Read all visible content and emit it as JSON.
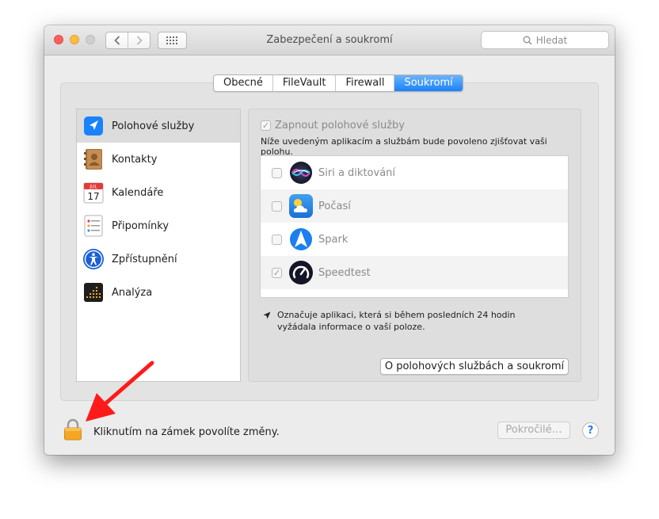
{
  "window": {
    "title": "Zabezpečení a soukromí",
    "search_placeholder": "Hledat"
  },
  "tabs": [
    {
      "label": "Obecné",
      "active": false
    },
    {
      "label": "FileVault",
      "active": false
    },
    {
      "label": "Firewall",
      "active": false
    },
    {
      "label": "Soukromí",
      "active": true
    }
  ],
  "sidebar": {
    "items": [
      {
        "label": "Polohové služby",
        "icon": "location-arrow-icon",
        "selected": true
      },
      {
        "label": "Kontakty",
        "icon": "contacts-icon",
        "selected": false
      },
      {
        "label": "Kalendáře",
        "icon": "calendar-icon",
        "icon_month": "JUL",
        "icon_day": "17",
        "selected": false
      },
      {
        "label": "Připomínky",
        "icon": "reminders-icon",
        "selected": false
      },
      {
        "label": "Zpřístupnění",
        "icon": "accessibility-icon",
        "selected": false
      },
      {
        "label": "Analýza",
        "icon": "analytics-icon",
        "selected": false
      }
    ]
  },
  "location": {
    "enable_label": "Zapnout polohové služby",
    "enable_checked": true,
    "description": "Níže uvedeným aplikacím a službám bude povoleno zjišťovat vaši polohu.",
    "apps": [
      {
        "name": "Siri a diktování",
        "checked": false,
        "icon": "siri-icon"
      },
      {
        "name": "Počasí",
        "checked": false,
        "icon": "weather-icon"
      },
      {
        "name": "Spark",
        "checked": false,
        "icon": "spark-icon"
      },
      {
        "name": "Speedtest",
        "checked": true,
        "icon": "speedtest-icon"
      }
    ],
    "note": "Označuje aplikaci, která si během posledních 24 hodin vyžádala informace o vaší poloze.",
    "about_button": "O polohových službách a soukromí"
  },
  "footer": {
    "lock_message": "Kliknutím na zámek povolíte změny.",
    "advanced_button": "Pokročilé…",
    "help_label": "?"
  },
  "colors": {
    "accent": "#1a82fb",
    "annotation_arrow": "#ff1a1a",
    "lock": "#f5a623"
  }
}
